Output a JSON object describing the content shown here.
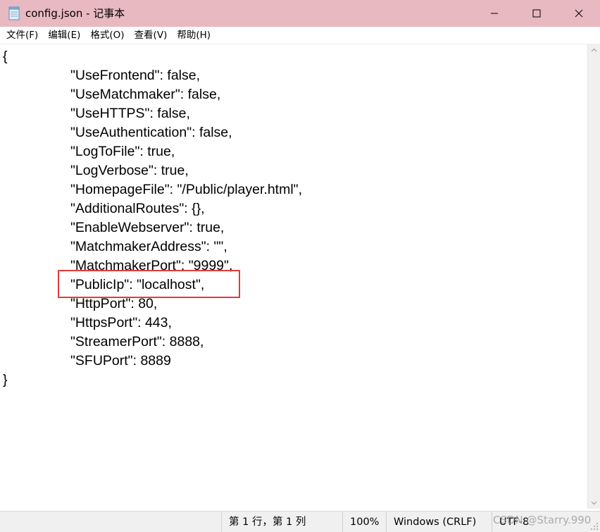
{
  "window": {
    "title": "config.json - 记事本",
    "titlebar_color": "#e8b9c0"
  },
  "menu": [
    "文件(F)",
    "编辑(E)",
    "格式(O)",
    "查看(V)",
    "帮助(H)"
  ],
  "document": {
    "lines": [
      {
        "indent": false,
        "text": "{"
      },
      {
        "indent": true,
        "text": "\"UseFrontend\": false,"
      },
      {
        "indent": true,
        "text": "\"UseMatchmaker\": false,"
      },
      {
        "indent": true,
        "text": "\"UseHTTPS\": false,"
      },
      {
        "indent": true,
        "text": "\"UseAuthentication\": false,"
      },
      {
        "indent": true,
        "text": "\"LogToFile\": true,"
      },
      {
        "indent": true,
        "text": "\"LogVerbose\": true,"
      },
      {
        "indent": true,
        "text": "\"HomepageFile\": \"/Public/player.html\","
      },
      {
        "indent": true,
        "text": "\"AdditionalRoutes\": {},"
      },
      {
        "indent": true,
        "text": "\"EnableWebserver\": true,"
      },
      {
        "indent": true,
        "text": "\"MatchmakerAddress\": \"\","
      },
      {
        "indent": true,
        "text": "\"MatchmakerPort\": \"9999\","
      },
      {
        "indent": true,
        "text": "\"PublicIp\": \"localhost\","
      },
      {
        "indent": true,
        "text": "\"HttpPort\": 80,"
      },
      {
        "indent": true,
        "text": "\"HttpsPort\": 443,"
      },
      {
        "indent": true,
        "text": "\"StreamerPort\": 8888,"
      },
      {
        "indent": true,
        "text": "\"SFUPort\": 8889"
      },
      {
        "indent": false,
        "text": "}"
      }
    ],
    "highlight_color": "#e03c3c"
  },
  "status": {
    "position": "第 1 行，第 1 列",
    "zoom": "100%",
    "line_ending": "Windows (CRLF)",
    "encoding": "UTF-8",
    "watermark": "CSDN @Starry.990"
  }
}
